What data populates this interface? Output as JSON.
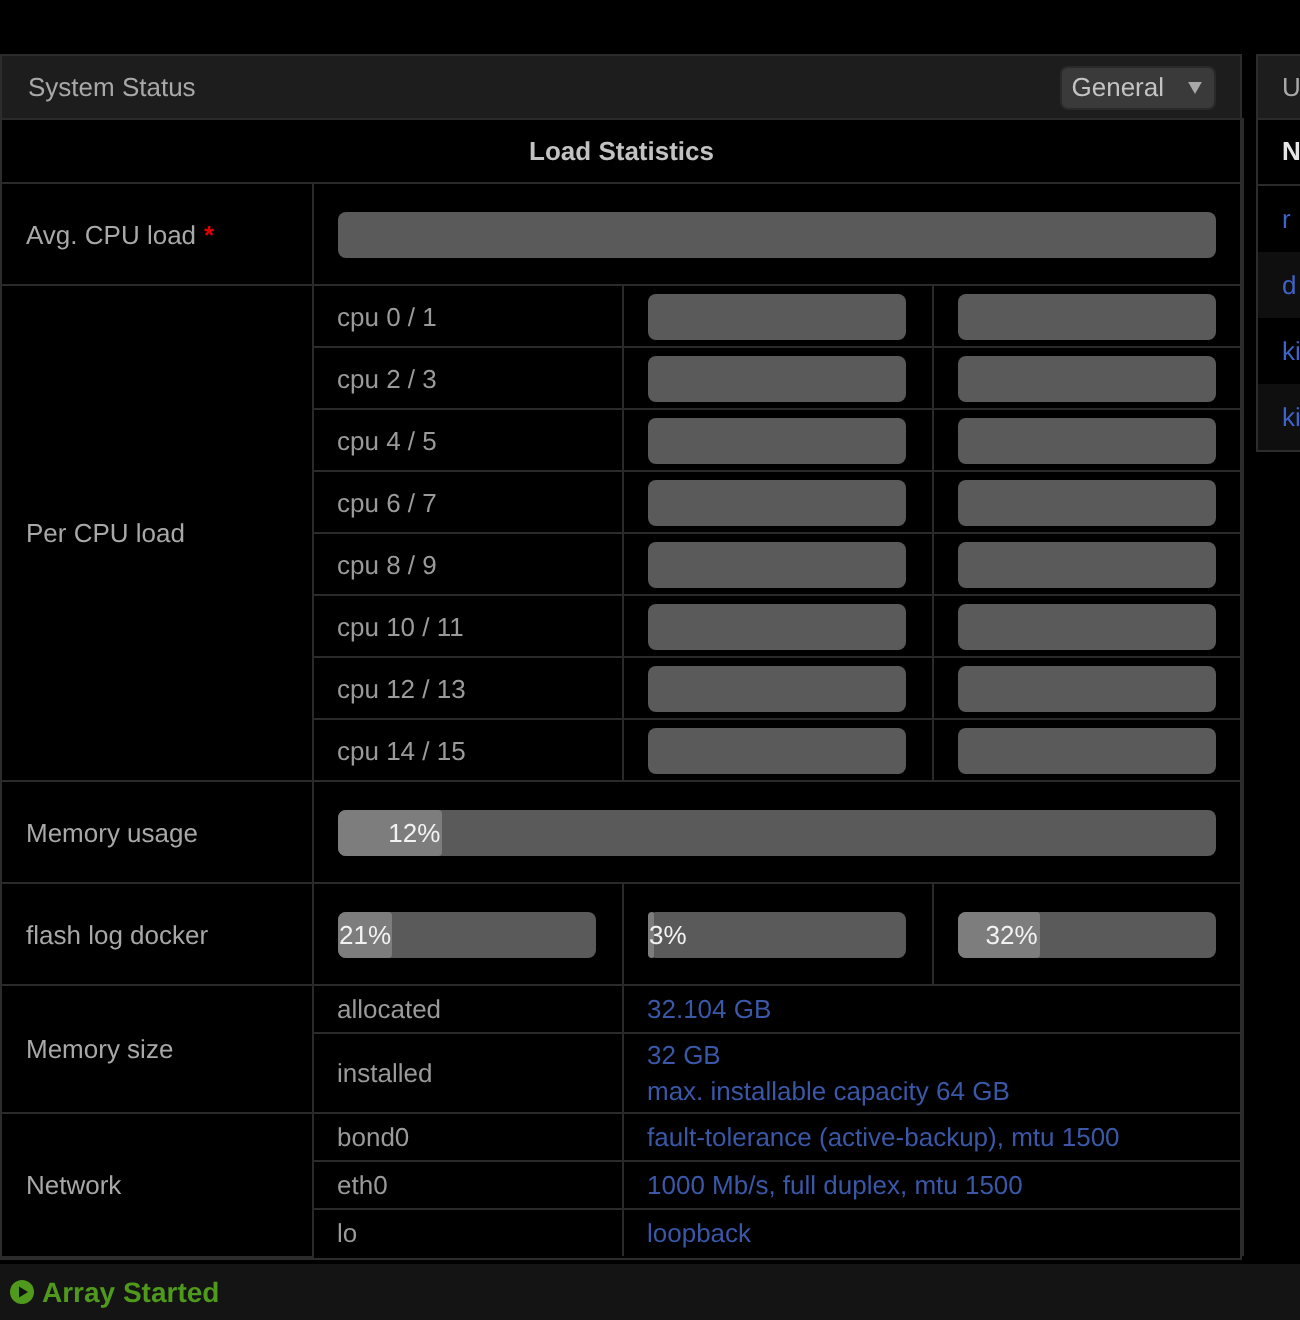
{
  "panel": {
    "title": "System Status",
    "view_select": {
      "value": "General"
    }
  },
  "load_statistics": {
    "title": "Load Statistics",
    "avg_cpu": {
      "label": "Avg. CPU load",
      "required_mark": "*"
    },
    "per_cpu": {
      "label": "Per CPU load",
      "rows": [
        {
          "name": "cpu 0 / 1"
        },
        {
          "name": "cpu 2 / 3"
        },
        {
          "name": "cpu 4 / 5"
        },
        {
          "name": "cpu 6 / 7"
        },
        {
          "name": "cpu 8 / 9"
        },
        {
          "name": "cpu 10 / 11"
        },
        {
          "name": "cpu 12 / 13"
        },
        {
          "name": "cpu 14 / 15"
        }
      ]
    },
    "memory_usage": {
      "label": "Memory usage",
      "meter": {
        "level": 0.12,
        "reading": "12%"
      }
    },
    "flash_log_docker": {
      "label": "flash log docker",
      "meters": [
        {
          "level": 0.21,
          "reading": "21%"
        },
        {
          "level": 0.03,
          "reading": "3%"
        },
        {
          "level": 0.32,
          "reading": "32%"
        }
      ]
    },
    "memory_size": {
      "label": "Memory size",
      "rows": [
        {
          "name": "allocated",
          "values": [
            "32.104 GB"
          ]
        },
        {
          "name": "installed",
          "values": [
            "32 GB",
            "max. installable capacity 64 GB"
          ]
        }
      ]
    },
    "network": {
      "label": "Network",
      "rows": [
        {
          "name": "bond0",
          "values": [
            "fault-tolerance (active-backup), mtu 1500"
          ]
        },
        {
          "name": "eth0",
          "values": [
            "1000 Mb/s, full duplex, mtu 1500"
          ]
        },
        {
          "name": "lo",
          "values": [
            "loopback"
          ]
        }
      ]
    }
  },
  "side_panel": {
    "title": "U",
    "column_header": "N",
    "rows": [
      "r",
      "d",
      "ki",
      "ki"
    ]
  },
  "status_bar": {
    "state": "Array Started"
  }
}
